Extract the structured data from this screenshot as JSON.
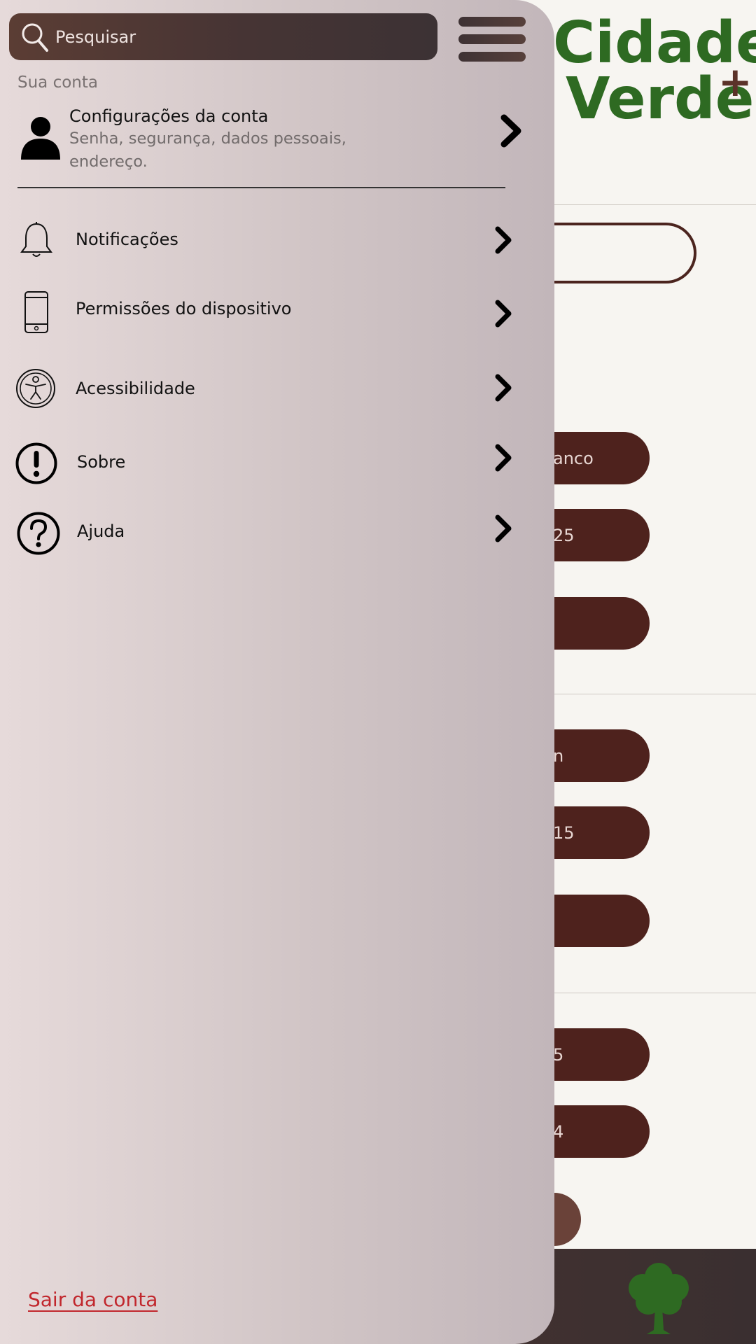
{
  "app": {
    "logo_line1": "Cidade",
    "logo_line2": "Verde",
    "logo_plus": "+",
    "brand_green": "#2e6a22",
    "brand_brown": "#4e221d"
  },
  "background": {
    "pills": [
      "anco",
      "25",
      "",
      "n",
      "15",
      "",
      "5",
      "4"
    ]
  },
  "drawer": {
    "search": {
      "placeholder": "Pesquisar",
      "icon": "search-icon"
    },
    "menu_icon": "hamburger-menu-icon",
    "section_label": "Sua conta",
    "account": {
      "title": "Configurações da conta",
      "subtitle": "Senha, segurança, dados pessoais, endereço.",
      "icon": "person-icon"
    },
    "items": [
      {
        "label": "Notificações",
        "icon": "bell-icon"
      },
      {
        "label": "Permissões do dispositivo",
        "icon": "smartphone-icon"
      },
      {
        "label": "Acessibilidade",
        "icon": "accessibility-icon"
      },
      {
        "label": "Sobre",
        "icon": "info-exclamation-icon"
      },
      {
        "label": "Ajuda",
        "icon": "help-question-icon"
      }
    ],
    "logout": "Sair da conta",
    "logout_color": "#c1272d"
  }
}
